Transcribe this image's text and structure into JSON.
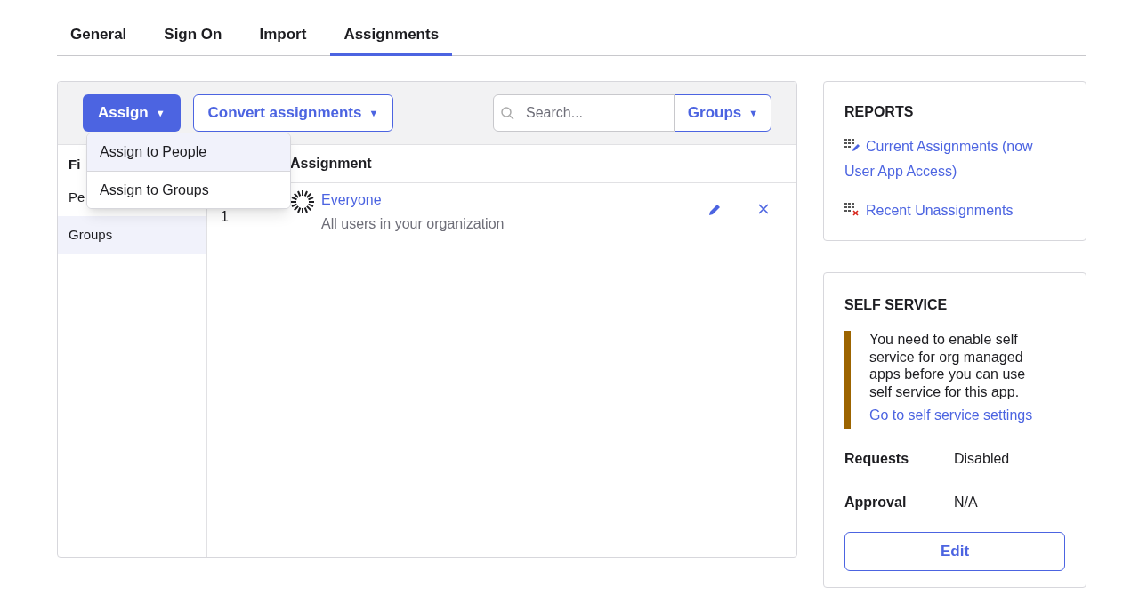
{
  "tabs": [
    {
      "label": "General",
      "selected": false
    },
    {
      "label": "Sign On",
      "selected": false
    },
    {
      "label": "Import",
      "selected": false
    },
    {
      "label": "Assignments",
      "selected": true
    }
  ],
  "toolbar": {
    "assign_button": "Assign",
    "assign_caret": "▼",
    "convert_button": "Convert assignments",
    "convert_caret": "▼",
    "search": {
      "placeholder": "Search..."
    },
    "search_scope": "Groups",
    "search_scope_caret": "▼"
  },
  "assign_menu": [
    {
      "label": "Assign to People",
      "selected": true
    },
    {
      "label": "Assign to Groups",
      "selected": false
    }
  ],
  "filters": {
    "title": "Fi",
    "items": [
      {
        "label": "Pe",
        "selected": false
      },
      {
        "label": "Groups",
        "selected": true
      }
    ]
  },
  "table": {
    "columns": [
      "Assignment"
    ],
    "rows": [
      {
        "number": "1",
        "name": "Everyone",
        "description": "All users in your organization"
      }
    ]
  },
  "reports": {
    "title": "REPORTS",
    "links": [
      {
        "kind": "current",
        "label": "Current Assignments (now User App Access)"
      },
      {
        "kind": "unassign",
        "label": "Recent Unassignments"
      }
    ]
  },
  "self_service": {
    "title": "SELF SERVICE",
    "notice": "You need to enable self service for org managed apps before you can use self service for this app.",
    "notice_link": "Go to self service settings",
    "fields": [
      {
        "label": "Requests",
        "value": "Disabled"
      },
      {
        "label": "Approval",
        "value": "N/A"
      }
    ],
    "edit_button": "Edit"
  }
}
